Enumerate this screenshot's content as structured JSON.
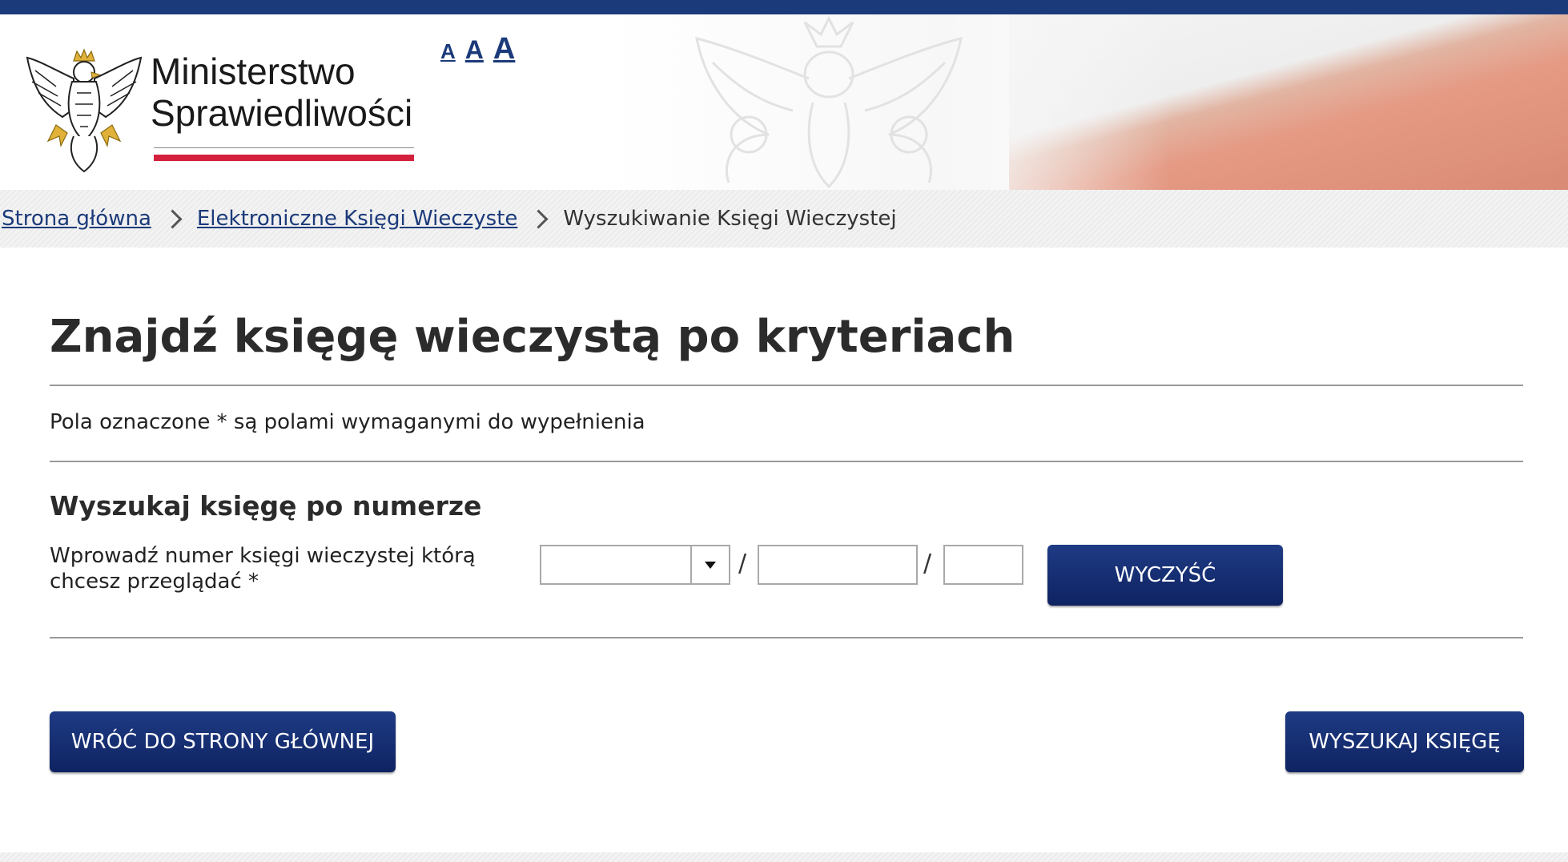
{
  "header": {
    "logo_line1": "Ministerstwo",
    "logo_line2": "Sprawiedliwości",
    "font_size_options": [
      "A",
      "A",
      "A"
    ]
  },
  "breadcrumb": {
    "items": [
      "Strona główna",
      "Elektroniczne Księgi Wieczyste"
    ],
    "current": "Wyszukiwanie Księgi Wieczystej"
  },
  "main": {
    "title": "Znajdź księgę wieczystą po kryteriach",
    "required_note": "Pola oznaczone * są polami wymaganymi do wypełnienia",
    "section_title": "Wyszukaj księgę po numerze",
    "field_label": "Wprowadź numer księgi wieczystej którą chcesz przeglądać *",
    "separator": "/",
    "court_code_value": "",
    "book_number_value": "",
    "check_digit_value": "",
    "clear_button": "WYCZYŚĆ"
  },
  "actions": {
    "back_button": "WRÓĆ DO STRONY GŁÓWNEJ",
    "search_button": "WYSZUKAJ KSIĘGĘ"
  },
  "colors": {
    "brand_navy": "#1b3a7a",
    "button_navy": "#0e2361",
    "accent_red": "#d4213d"
  },
  "icons": [
    "eagle-emblem-icon",
    "eagle-watermark-icon",
    "chevron-right-icon",
    "dropdown-caret-icon"
  ]
}
